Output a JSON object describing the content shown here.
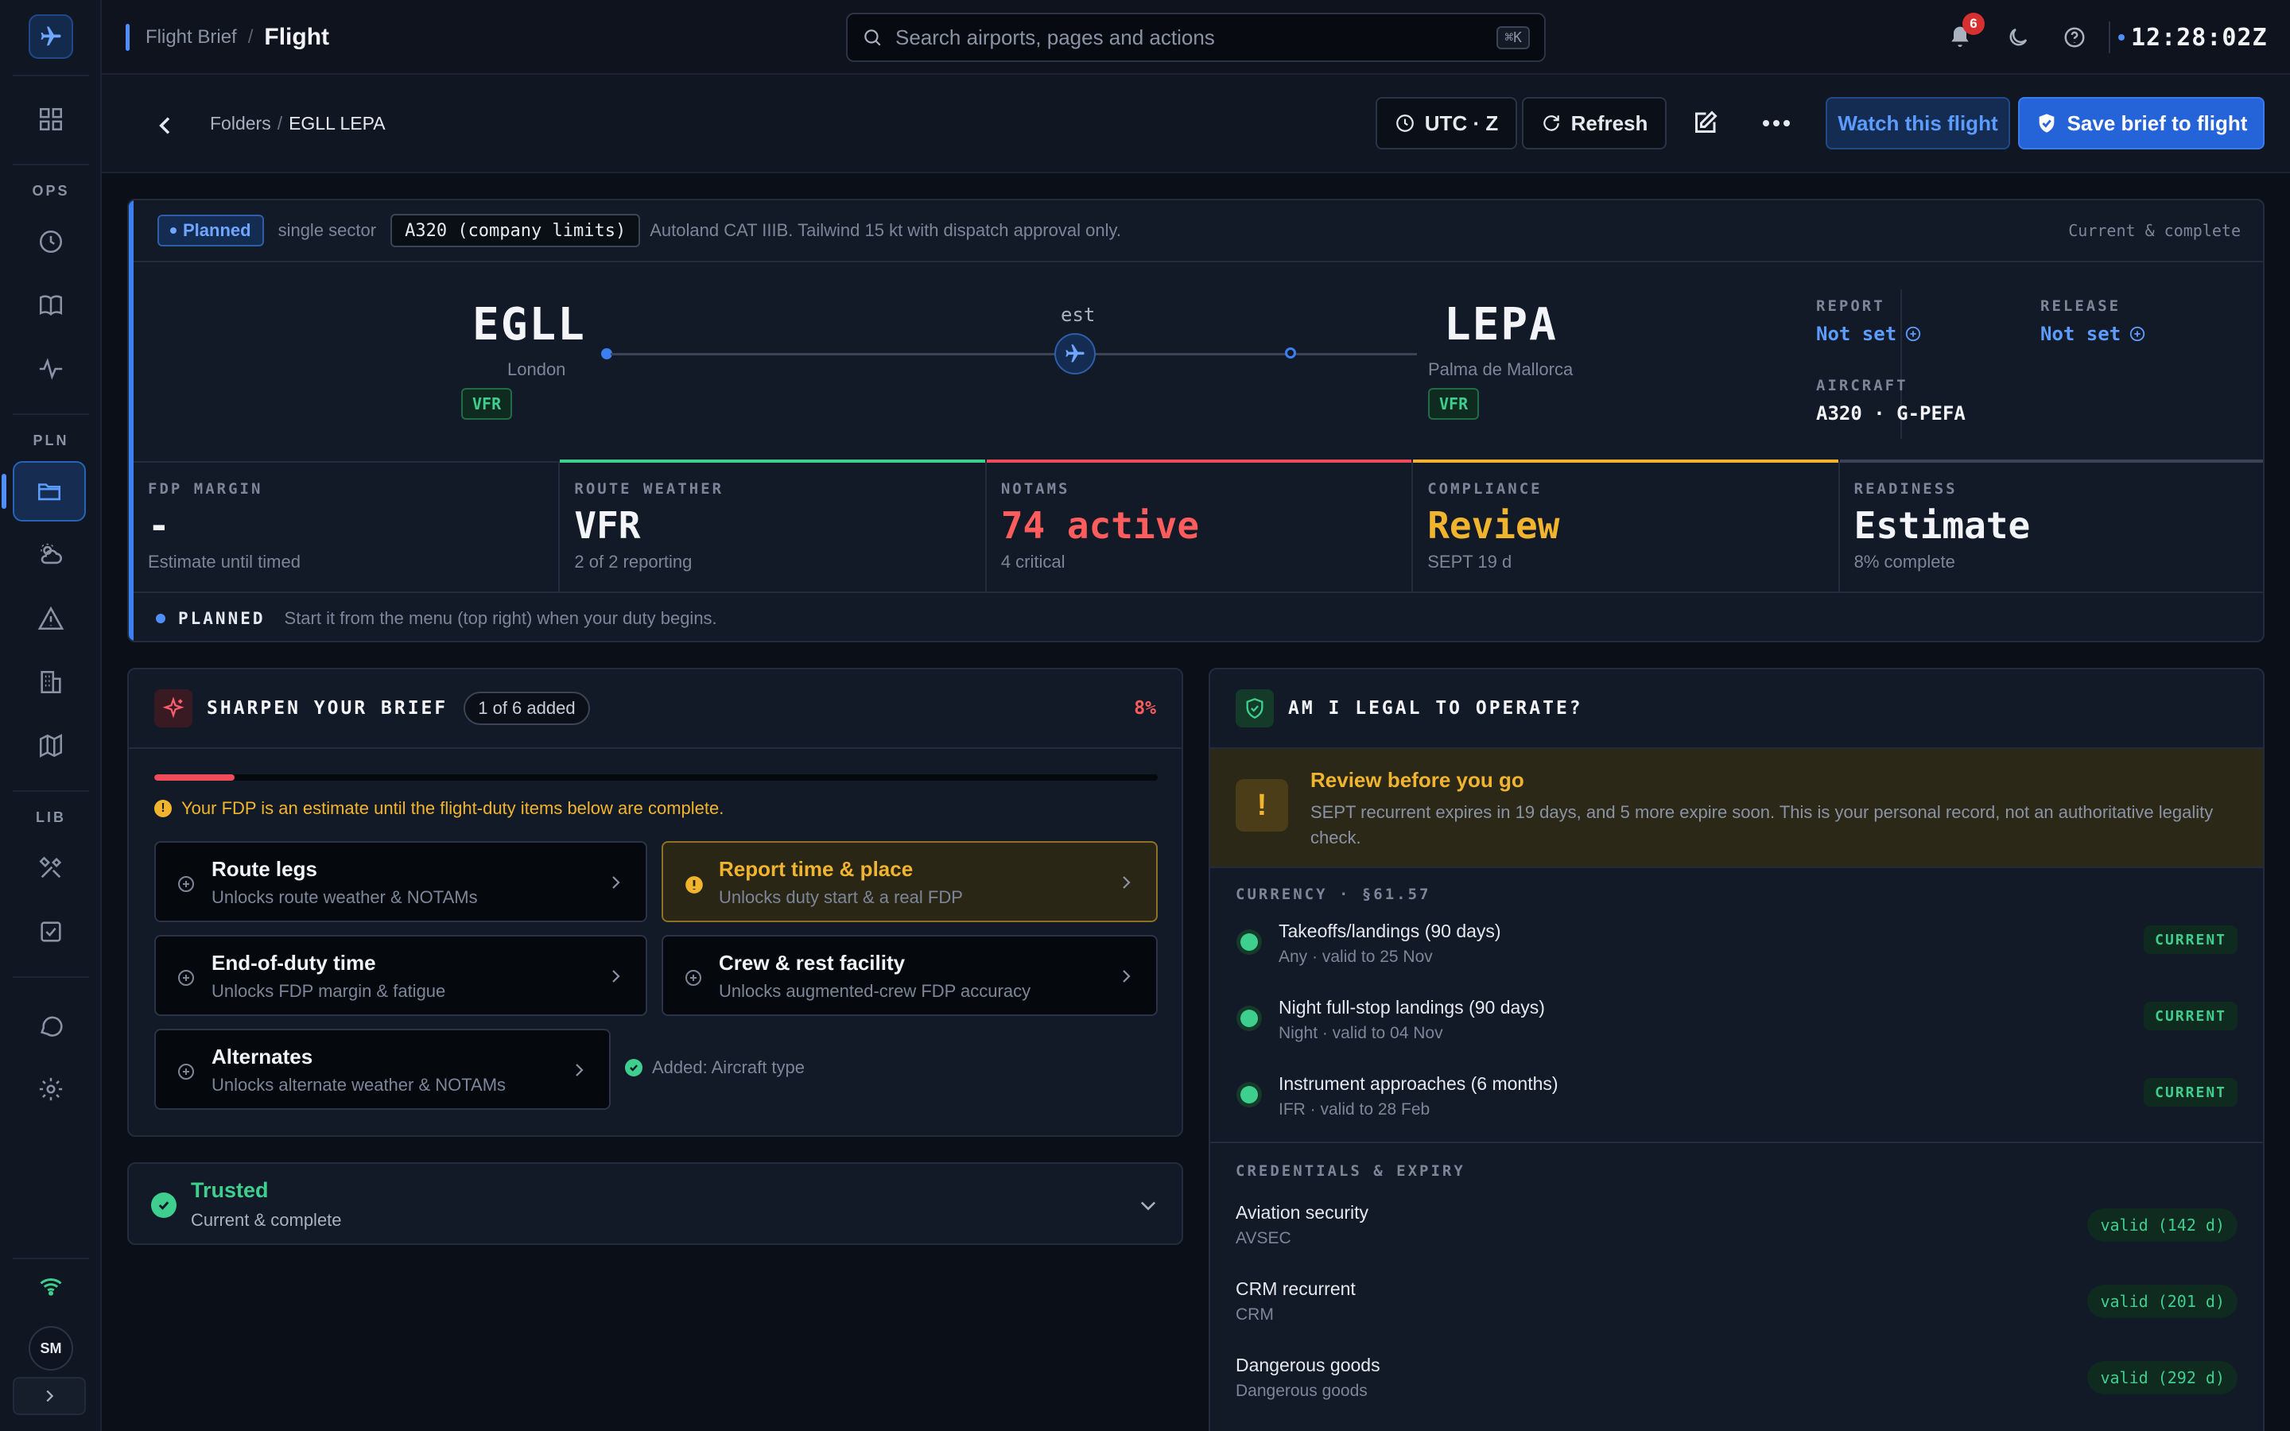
{
  "topbar": {
    "crumb_parent": "Flight Brief",
    "crumb_current": "Flight",
    "search_placeholder": "Search airports, pages and actions",
    "search_shortcut": "⌘K",
    "notification_count": "6",
    "clock": "12:28:02Z"
  },
  "sidebar": {
    "sections": [
      "OPS",
      "PLN",
      "LIB"
    ],
    "avatar_initials": "SM",
    "items": [
      {
        "icon": "dashboard-icon"
      },
      {
        "icon": "clock-icon"
      },
      {
        "icon": "book-icon"
      },
      {
        "icon": "activity-icon"
      },
      {
        "icon": "folder-icon",
        "active": true
      },
      {
        "icon": "weather-icon"
      },
      {
        "icon": "warning-icon"
      },
      {
        "icon": "building-icon"
      },
      {
        "icon": "map-icon"
      },
      {
        "icon": "tools-icon"
      },
      {
        "icon": "checklist-icon"
      },
      {
        "icon": "chat-icon"
      },
      {
        "icon": "gear-icon"
      }
    ]
  },
  "subheader": {
    "folders": "Folders",
    "current": "EGLL LEPA",
    "utc_label": "UTC · Z",
    "refresh_label": "Refresh",
    "watch_label": "Watch this flight",
    "save_label": "Save brief to flight"
  },
  "flight": {
    "status": "Planned",
    "sector": "single sector",
    "limits": "A320 (company limits)",
    "note": "Autoland CAT IIIB. Tailwind 15 kt with dispatch approval only.",
    "data_status": "Current & complete",
    "origin": {
      "code": "EGLL",
      "city": "London",
      "rules": "VFR"
    },
    "destination": {
      "code": "LEPA",
      "city": "Palma de Mallorca",
      "rules": "VFR"
    },
    "est_label": "est",
    "report_label": "REPORT",
    "report_value": "Not set",
    "release_label": "RELEASE",
    "release_value": "Not set",
    "aircraft_label": "AIRCRAFT",
    "aircraft_value": "A320 · G-PEFA",
    "stats": [
      {
        "label": "FDP MARGIN",
        "value": "-",
        "sub": "Estimate until timed",
        "color": "#f2f4f8",
        "top": "transparent"
      },
      {
        "label": "ROUTE WEATHER",
        "value": "VFR",
        "sub": "2 of 2 reporting",
        "color": "#f2f4f8",
        "top": "#3ecf8e"
      },
      {
        "label": "NOTAMS",
        "value": "74 active",
        "sub": "4 critical",
        "color": "#ff5d5d",
        "top": "#ef4b59"
      },
      {
        "label": "COMPLIANCE",
        "value": "Review",
        "sub": "SEPT 19 d",
        "color": "#f1b42f",
        "top": "#f1b42f"
      },
      {
        "label": "READINESS",
        "value": "Estimate",
        "sub": "8% complete",
        "color": "#f2f4f8",
        "top": "#3a4456"
      }
    ],
    "footer_key": "PLANNED",
    "footer_text": "Start it from the menu (top right) when your duty begins."
  },
  "sharpen": {
    "title": "SHARPEN YOUR BRIEF",
    "count": "1 of 6 added",
    "percent": "8%",
    "progress": 0.08,
    "warning": "Your FDP is an estimate until the flight-duty items below are complete.",
    "tasks": [
      {
        "title": "Route legs",
        "sub": "Unlocks route weather & NOTAMs"
      },
      {
        "title": "Report time & place",
        "sub": "Unlocks duty start & a real FDP"
      },
      {
        "title": "End-of-duty time",
        "sub": "Unlocks FDP margin & fatigue"
      },
      {
        "title": "Crew & rest facility",
        "sub": "Unlocks augmented-crew FDP accuracy"
      },
      {
        "title": "Alternates",
        "sub": "Unlocks alternate weather & NOTAMs"
      }
    ],
    "added": "Added: Aircraft type"
  },
  "trusted": {
    "title": "Trusted",
    "sub": "Current & complete"
  },
  "legal": {
    "title": "AM I LEGAL TO OPERATE?",
    "review_title": "Review before you go",
    "review_text": "SEPT recurrent expires in 19 days, and 5 more expire soon. This is your personal record, not an authoritative legality check.",
    "currency_label": "CURRENCY · §61.57",
    "currency": [
      {
        "name": "Takeoffs/landings (90 days)",
        "sub": "Any · valid to 25 Nov",
        "badge": "CURRENT"
      },
      {
        "name": "Night full-stop landings (90 days)",
        "sub": "Night · valid to 04 Nov",
        "badge": "CURRENT"
      },
      {
        "name": "Instrument approaches (6 months)",
        "sub": "IFR · valid to 28 Feb",
        "badge": "CURRENT"
      }
    ],
    "credentials_label": "CREDENTIALS & EXPIRY",
    "credentials": [
      {
        "name": "Aviation security",
        "sub": "AVSEC",
        "badge": "valid (142 d)"
      },
      {
        "name": "CRM recurrent",
        "sub": "CRM",
        "badge": "valid (201 d)"
      },
      {
        "name": "Dangerous goods",
        "sub": "Dangerous goods",
        "badge": "valid (292 d)"
      }
    ]
  }
}
